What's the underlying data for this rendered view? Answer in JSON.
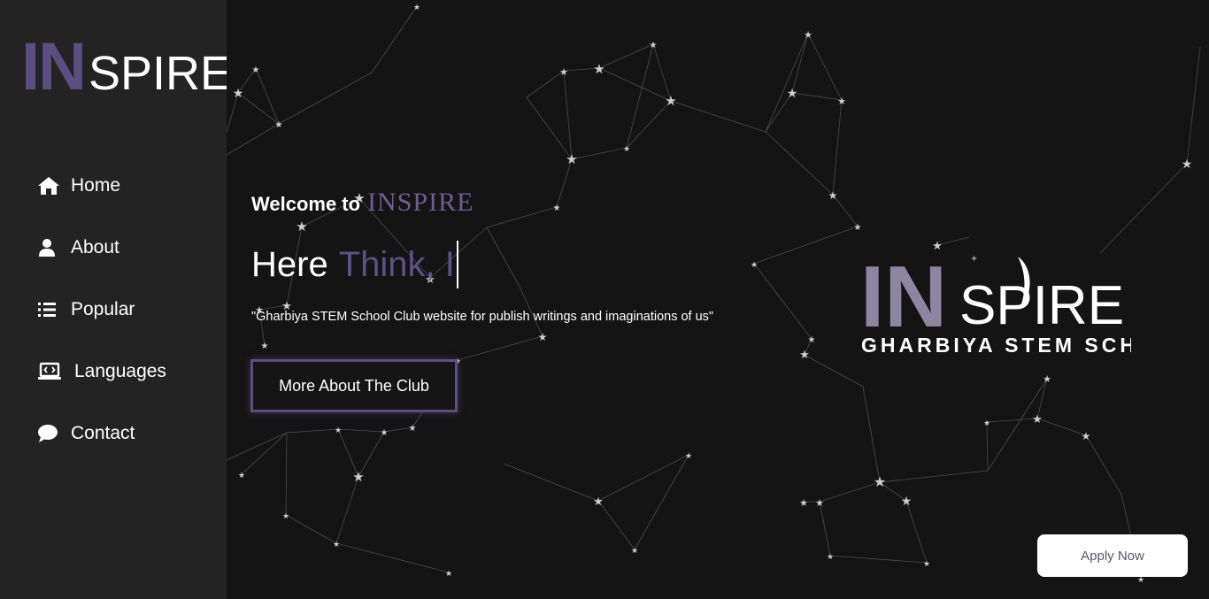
{
  "logo": {
    "prefix": "IN",
    "suffix": "SPIRE"
  },
  "nav": [
    {
      "label": "Home",
      "icon": "home-icon"
    },
    {
      "label": "About",
      "icon": "user-icon"
    },
    {
      "label": "Popular",
      "icon": "list-icon"
    },
    {
      "label": "Languages",
      "icon": "laptop-code-icon"
    },
    {
      "label": "Contact",
      "icon": "comment-icon"
    }
  ],
  "hero": {
    "welcome": "Welcome to",
    "brand": "INSPIRE",
    "headline_static": "Here",
    "headline_typed": "Think, I",
    "tagline": "\"Gharbiya STEM School Club website for publish writings and imaginations of us\"",
    "more_button": "More About The Club"
  },
  "club_logo": {
    "in": "IN",
    "spire": "SPIRE",
    "school": "GHARBIYA STEM SCHOOL"
  },
  "apply_button": "Apply Now",
  "colors": {
    "sidebar_bg": "#232323",
    "page_bg": "#141414",
    "accent": "#5b4f82",
    "text": "#ffffff"
  }
}
